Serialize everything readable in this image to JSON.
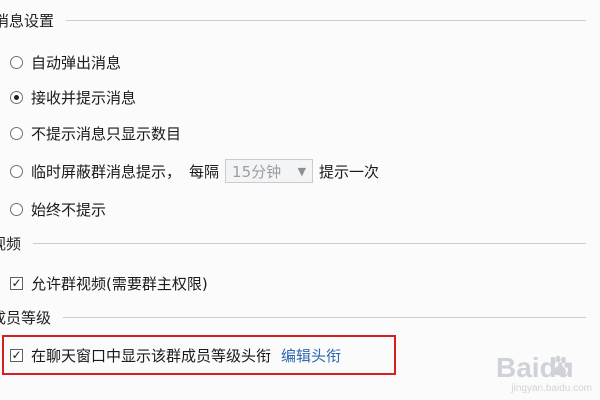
{
  "sections": {
    "messages": {
      "title": "消息设置"
    },
    "video": {
      "title": "视频"
    },
    "member_level": {
      "title": "成员等级"
    }
  },
  "message_options": [
    {
      "label": "自动弹出消息",
      "checked": false
    },
    {
      "label": "接收并提示消息",
      "checked": true
    },
    {
      "label": "不提示消息只显示数目",
      "checked": false
    },
    {
      "label": "临时屏蔽群消息提示，",
      "checked": false,
      "interval_label": "每隔",
      "interval_value": "15分钟",
      "suffix": "提示一次"
    },
    {
      "label": "始终不提示",
      "checked": false
    }
  ],
  "video_options": [
    {
      "label": "允许群视频(需要群主权限)",
      "checked": true
    }
  ],
  "member_level_options": [
    {
      "label": "在聊天窗口中显示该群成员等级头衔",
      "checked": true,
      "link": "编辑头衔"
    }
  ],
  "watermark": {
    "brand": "Baidu",
    "url": "jingyan.baidu.com"
  },
  "colors": {
    "highlight_border": "#d61f1f",
    "link": "#2f67b3"
  },
  "icons": {
    "dropdown": "chevron-down-icon"
  }
}
